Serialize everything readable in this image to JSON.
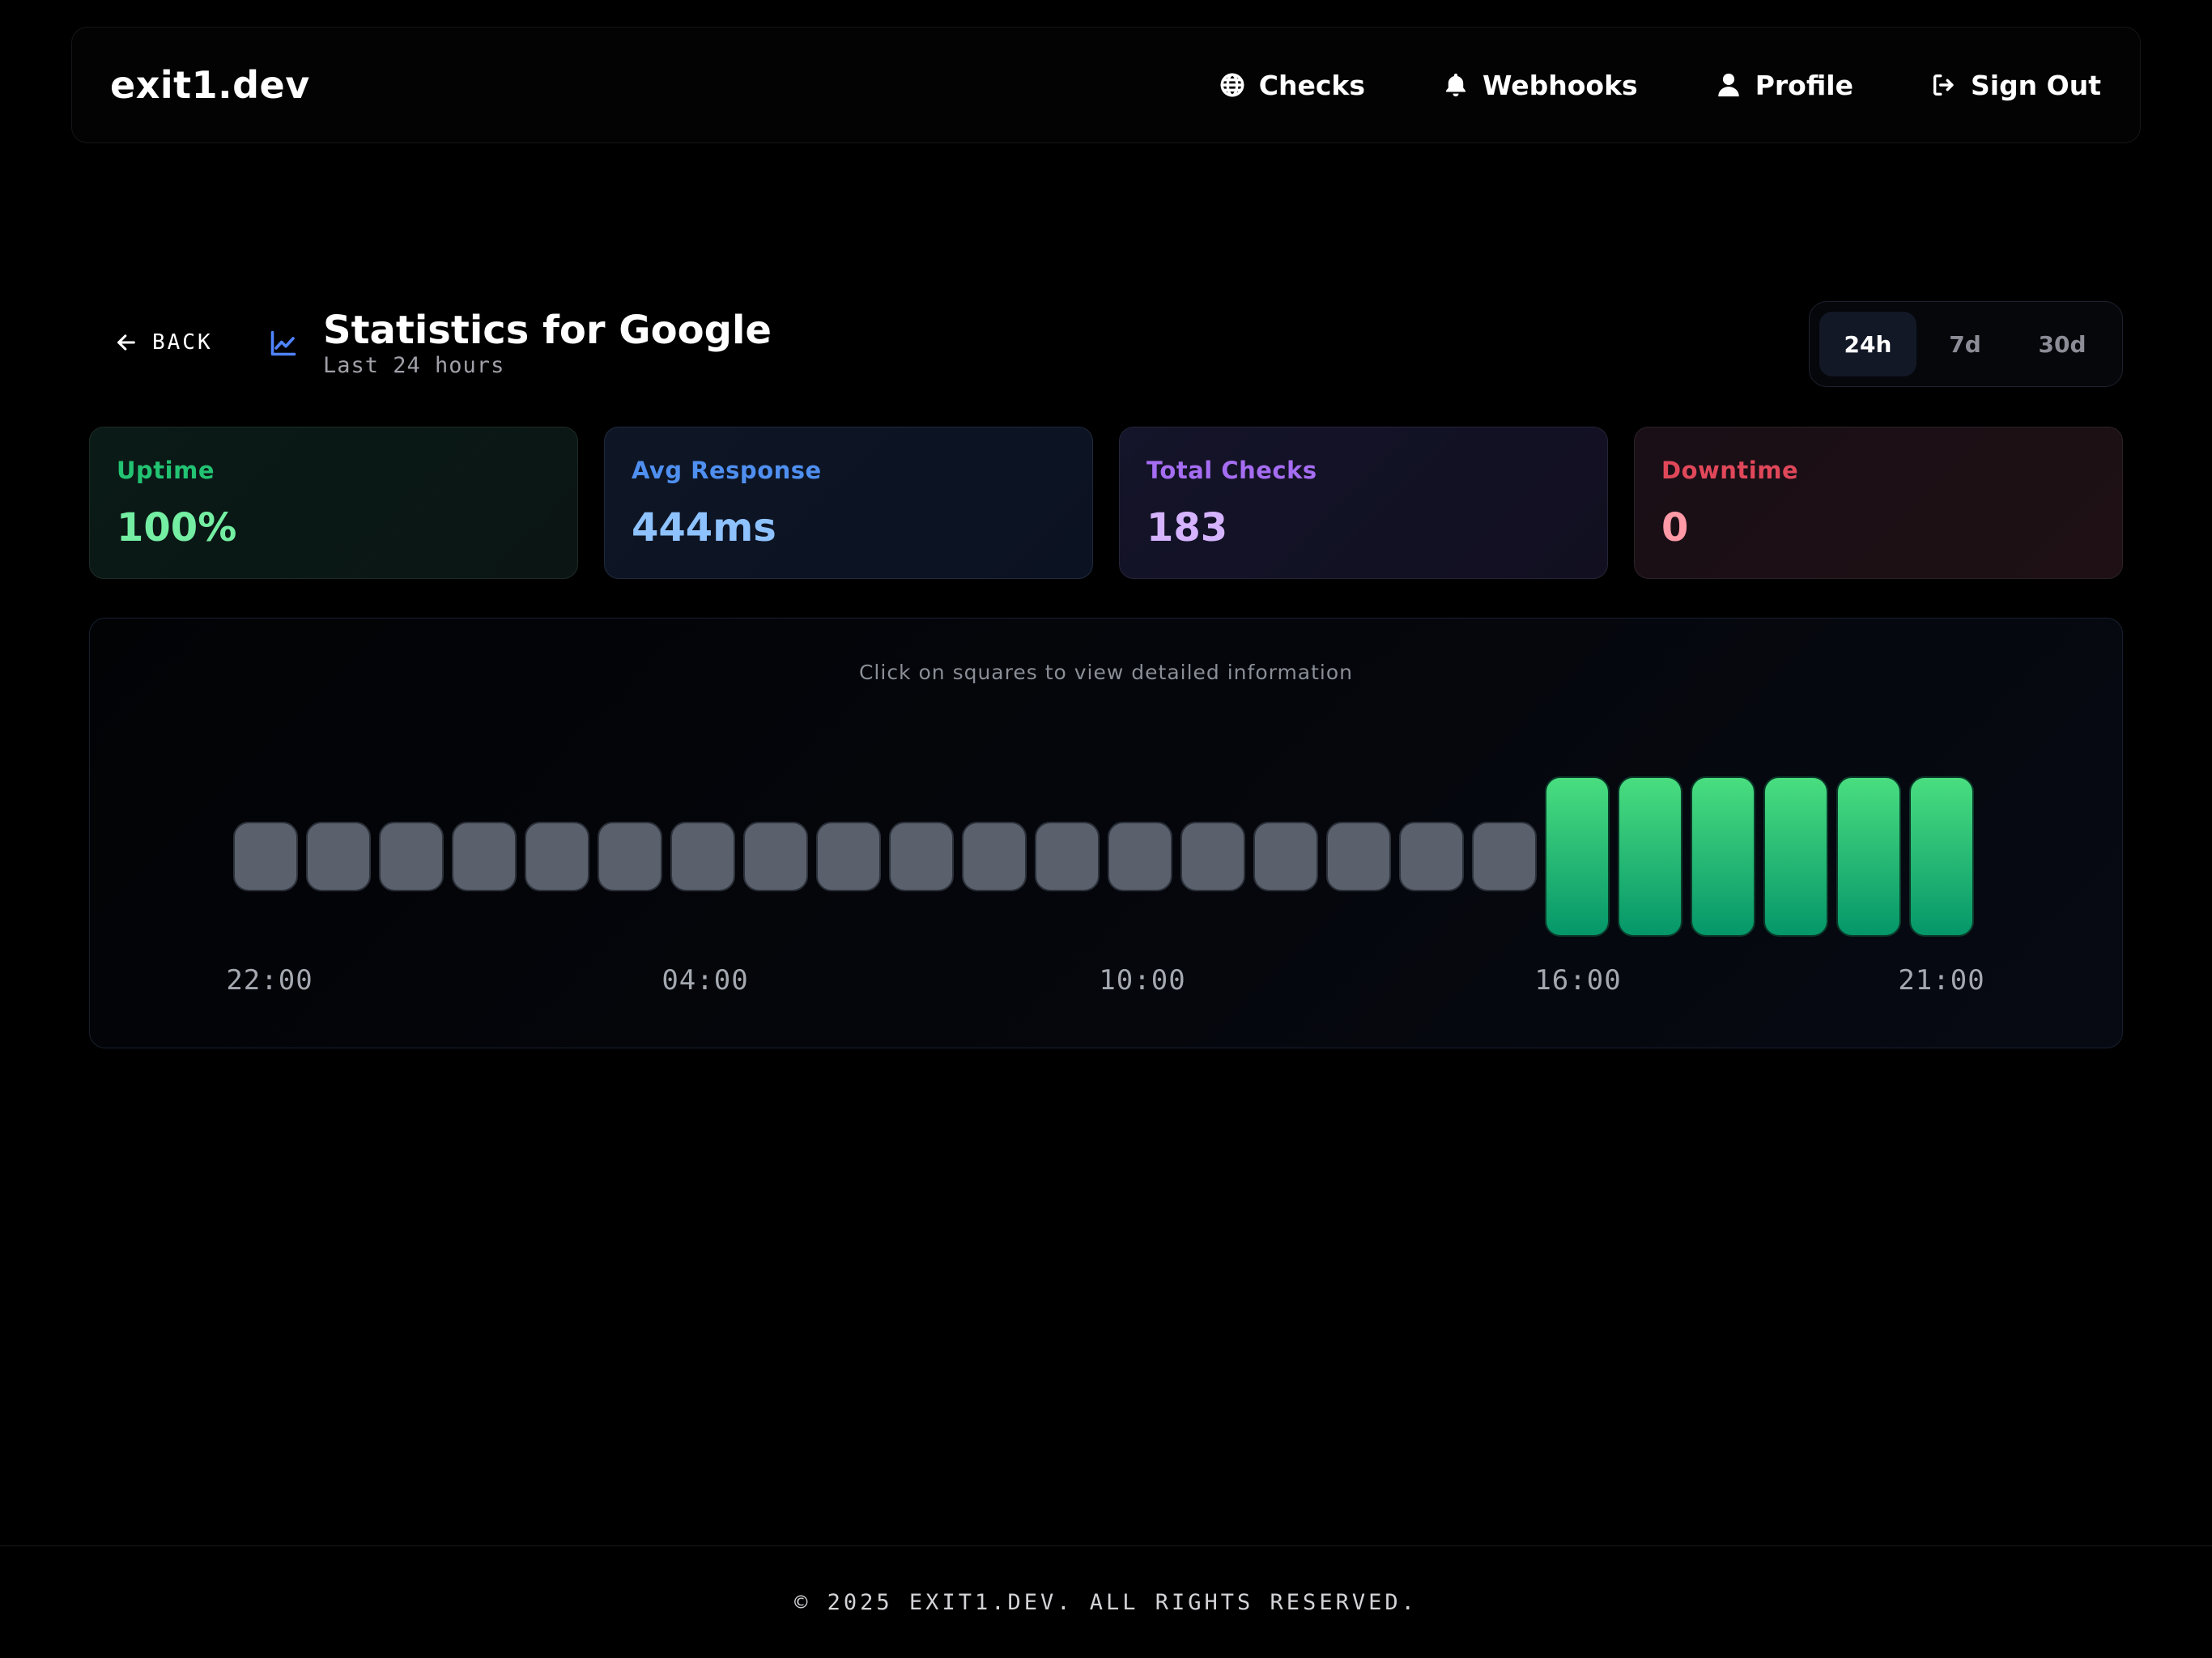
{
  "nav": {
    "logo": "exit1.dev",
    "links": [
      {
        "label": "Checks",
        "icon": "globe-icon"
      },
      {
        "label": "Webhooks",
        "icon": "bell-icon"
      },
      {
        "label": "Profile",
        "icon": "user-icon"
      },
      {
        "label": "Sign Out",
        "icon": "sign-out-icon"
      }
    ]
  },
  "header": {
    "back_label": "BACK",
    "title": "Statistics for Google",
    "subtitle": "Last 24 hours",
    "ranges": [
      "24h",
      "7d",
      "30d"
    ],
    "active_range": "24h"
  },
  "stats": {
    "uptime": {
      "label": "Uptime",
      "value": "100%"
    },
    "avg_response": {
      "label": "Avg Response",
      "value": "444ms"
    },
    "total_checks": {
      "label": "Total Checks",
      "value": "183"
    },
    "downtime": {
      "label": "Downtime",
      "value": "0"
    }
  },
  "history": {
    "hint": "Click on squares to view detailed information",
    "slots": [
      "no-data",
      "no-data",
      "no-data",
      "no-data",
      "no-data",
      "no-data",
      "no-data",
      "no-data",
      "no-data",
      "no-data",
      "no-data",
      "no-data",
      "no-data",
      "no-data",
      "no-data",
      "no-data",
      "no-data",
      "no-data",
      "up",
      "up",
      "up",
      "up",
      "up",
      "up"
    ],
    "time_labels": [
      "22:00",
      "04:00",
      "10:00",
      "16:00",
      "21:00"
    ],
    "colors": {
      "up_top": "#4ade80",
      "up_bottom": "#059669",
      "no_data": "#5a616d"
    }
  },
  "footer": {
    "text": "© 2025 EXIT1.DEV. ALL RIGHTS RESERVED."
  }
}
